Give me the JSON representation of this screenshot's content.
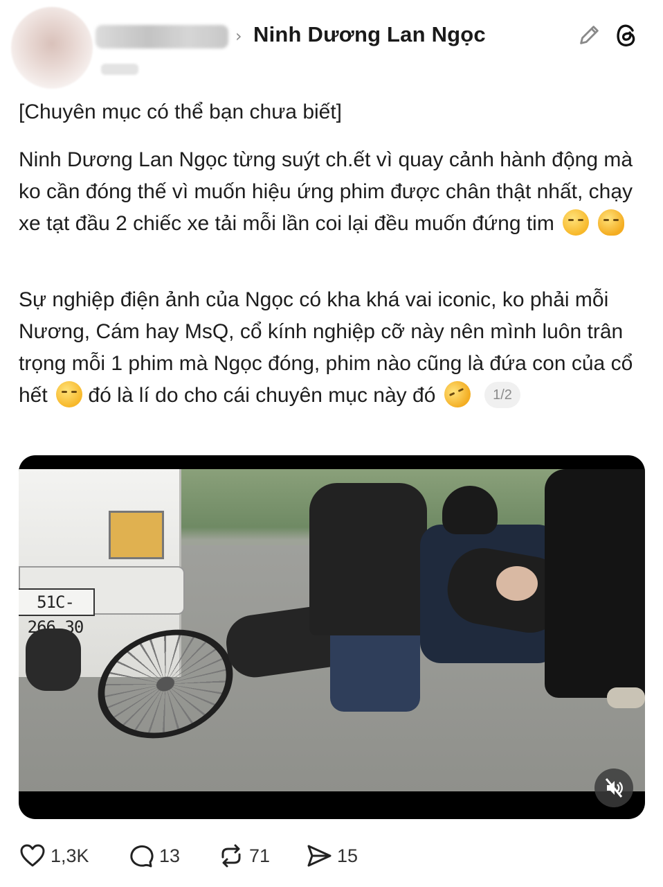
{
  "header": {
    "chevron": "›",
    "title": "Ninh Dương Lan Ngọc",
    "edit_icon": "pencil-icon",
    "app_icon": "threads-logo-icon"
  },
  "post": {
    "tag": "[Chuyên mục có thể bạn chưa biết]",
    "paragraph1": "Ninh Dương Lan Ngọc từng suýt ch.ết vì quay cảnh hành động mà ko cần đóng thế vì muốn hiệu ứng phim được chân thật nhất, chạy xe tạt đầu 2 chiếc xe tải mỗi lần coi lại đều muốn đứng tim",
    "paragraph2_a": "Sự nghiệp điện ảnh của Ngọc có kha khá vai iconic, ko phải mỗi Nương, Cám hay MsQ, cổ kính nghiệp cỡ này nên mình luôn trân trọng mỗi 1 phim mà Ngọc đóng, phim nào cũng là đứa con của cổ hết",
    "paragraph2_b": "đó là lí do cho cái chuyên mục này đó",
    "page_indicator": "1/2"
  },
  "media": {
    "plate_text": "51C-266.30",
    "mute_icon": "speaker-muted-icon"
  },
  "actions": {
    "likes": "1,3K",
    "comments": "13",
    "reposts": "71",
    "shares": "15"
  }
}
